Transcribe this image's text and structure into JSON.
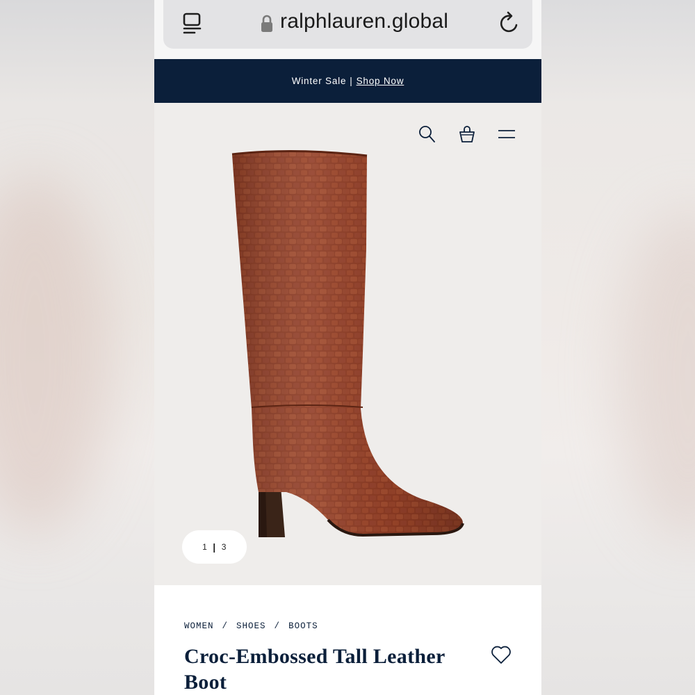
{
  "browser": {
    "url": "ralphlauren.global"
  },
  "promo_banner": {
    "text": "Winter Sale",
    "separator": "|",
    "link": "Shop Now"
  },
  "header_icons": [
    "search-icon",
    "shopping-bag-icon",
    "hamburger-menu-icon"
  ],
  "gallery": {
    "current": "1",
    "separator": "|",
    "total": "3"
  },
  "breadcrumb": {
    "items": [
      "WOMEN",
      "SHOES",
      "BOOTS"
    ],
    "separator": "/"
  },
  "product": {
    "title": "Croc-Embossed Tall Leather Boot"
  },
  "colors": {
    "navy": "#0b1f3a",
    "boot_leather": "#8a3a22",
    "hero_bg": "#efedeb"
  }
}
